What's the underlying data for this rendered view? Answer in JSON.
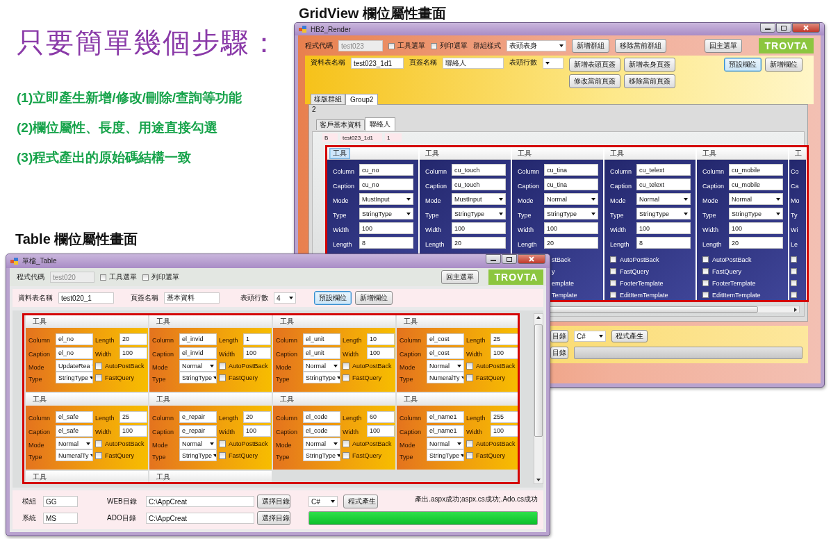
{
  "slide": {
    "title": "只要簡單幾個步驟：",
    "steps": [
      "(1)立即產生新增/修改/刪除/查詢等功能",
      "(2)欄位屬性、長度、用途直接勾選",
      "(3)程式產出的原始碼結構一致"
    ],
    "gridview_caption": "GridView 欄位屬性畫面",
    "table_caption": "Table 欄位屬性畫面"
  },
  "gridview_window": {
    "title": "HB2_Render",
    "program_code": {
      "label": "程式代碼",
      "value": "test023",
      "disabled": true
    },
    "checkboxes": [
      {
        "label": "工具選單",
        "checked": false
      },
      {
        "label": "列印選單",
        "checked": false
      }
    ],
    "group_style": {
      "label": "群組樣式",
      "value": "表頭表身"
    },
    "group_buttons": [
      "新增群組",
      "移除當前群組"
    ],
    "home_button": "回主選單",
    "logo": "TROVTA",
    "table_name": {
      "label": "資料表名稱",
      "value": "test023_1d1"
    },
    "tab_name": {
      "label": "頁簽名稱",
      "value": "聯絡人"
    },
    "header_rows": {
      "label": "表頭行數"
    },
    "tab_buttons": [
      [
        "新增表頭頁簽",
        "新增表身頁簽"
      ],
      [
        "修改當前頁簽",
        "移除當前頁簽"
      ]
    ],
    "field_buttons": [
      {
        "label": "預設欄位",
        "focused": true
      },
      {
        "label": "新增欄位",
        "focused": false
      }
    ],
    "group_tabs": [
      {
        "label": "樣版群組",
        "selected": false
      },
      {
        "label": "Group2",
        "selected": true
      }
    ],
    "group_number": "2",
    "page_tabs": [
      {
        "label": "客戶基本資料",
        "selected": false
      },
      {
        "label": "聯絡人",
        "selected": true
      }
    ],
    "info_fields": [
      "B",
      "test023_1d1",
      "1"
    ],
    "cards": [
      {
        "kind": "full",
        "tool": "工具",
        "focused": true,
        "fields": [
          {
            "label": "Column",
            "value": "cu_no",
            "kind": "text"
          },
          {
            "label": "Caption",
            "value": "cu_no",
            "kind": "text"
          },
          {
            "label": "Mode",
            "value": "MustInput",
            "kind": "select"
          },
          {
            "label": "Type",
            "value": "StringType",
            "kind": "select"
          },
          {
            "label": "Width",
            "value": "100",
            "kind": "text"
          },
          {
            "label": "Length",
            "value": "8",
            "kind": "text"
          }
        ]
      },
      {
        "kind": "full",
        "tool": "工具",
        "focused": false,
        "fields": [
          {
            "label": "Column",
            "value": "cu_touch",
            "kind": "text"
          },
          {
            "label": "Caption",
            "value": "cu_touch",
            "kind": "text"
          },
          {
            "label": "Mode",
            "value": "MustInput",
            "kind": "select"
          },
          {
            "label": "Type",
            "value": "StringType",
            "kind": "select"
          },
          {
            "label": "Width",
            "value": "100",
            "kind": "text"
          },
          {
            "label": "Length",
            "value": "20",
            "kind": "text"
          }
        ]
      },
      {
        "kind": "full",
        "tool": "工具",
        "focused": false,
        "fields": [
          {
            "label": "Column",
            "value": "cu_tina",
            "kind": "text"
          },
          {
            "label": "Caption",
            "value": "cu_tina",
            "kind": "text"
          },
          {
            "label": "Mode",
            "value": "Normal",
            "kind": "select"
          },
          {
            "label": "Type",
            "value": "StringType",
            "kind": "select"
          },
          {
            "label": "Width",
            "value": "100",
            "kind": "text"
          },
          {
            "label": "Length",
            "value": "20",
            "kind": "text"
          }
        ],
        "options": [
          {
            "kind": "partial",
            "label": "stBack"
          },
          {
            "kind": "partial",
            "label": "y"
          },
          {
            "kind": "partial",
            "label": "emplate"
          },
          {
            "kind": "partial",
            "label": "Template"
          }
        ]
      },
      {
        "kind": "full",
        "tool": "工具",
        "focused": false,
        "fields": [
          {
            "label": "Column",
            "value": "cu_telext",
            "kind": "text"
          },
          {
            "label": "Caption",
            "value": "cu_telext",
            "kind": "text"
          },
          {
            "label": "Mode",
            "value": "Normal",
            "kind": "select"
          },
          {
            "label": "Type",
            "value": "StringType",
            "kind": "select"
          },
          {
            "label": "Width",
            "value": "100",
            "kind": "text"
          },
          {
            "label": "Length",
            "value": "8",
            "kind": "text"
          }
        ],
        "options": [
          {
            "kind": "checkbox",
            "label": "AutoPostBack",
            "checked": false
          },
          {
            "kind": "checkbox",
            "label": "FastQuery",
            "checked": false
          },
          {
            "kind": "checkbox",
            "label": "FooterTemplate",
            "checked": false
          },
          {
            "kind": "checkbox",
            "label": "EditItemTemplate",
            "checked": false
          }
        ]
      },
      {
        "kind": "full",
        "tool": "工具",
        "focused": false,
        "fields": [
          {
            "label": "Column",
            "value": "cu_mobile",
            "kind": "text"
          },
          {
            "label": "Caption",
            "value": "cu_mobile",
            "kind": "text"
          },
          {
            "label": "Mode",
            "value": "Normal",
            "kind": "select"
          },
          {
            "label": "Type",
            "value": "StringType",
            "kind": "select"
          },
          {
            "label": "Width",
            "value": "100",
            "kind": "text"
          },
          {
            "label": "Length",
            "value": "20",
            "kind": "text"
          }
        ],
        "options": [
          {
            "kind": "checkbox",
            "label": "AutoPostBack",
            "checked": false
          },
          {
            "kind": "checkbox",
            "label": "FastQuery",
            "checked": false
          },
          {
            "kind": "checkbox",
            "label": "FooterTemplate",
            "checked": false
          },
          {
            "kind": "checkbox",
            "label": "EditItemTemplate",
            "checked": false
          }
        ]
      },
      {
        "kind": "edge",
        "tool": "工",
        "focused": false,
        "fields": [
          {
            "label": "Co",
            "kind": "label_only"
          },
          {
            "label": "Ca",
            "kind": "label_only"
          },
          {
            "label": "Mo",
            "kind": "label_only"
          },
          {
            "label": "Ty",
            "kind": "label_only"
          },
          {
            "label": "Wi",
            "kind": "label_only"
          },
          {
            "label": "Le",
            "kind": "label_only"
          }
        ],
        "options": [
          {
            "kind": "box",
            "checked": false
          },
          {
            "kind": "box",
            "checked": false
          },
          {
            "kind": "box",
            "checked": false
          },
          {
            "kind": "box",
            "checked": false
          }
        ]
      }
    ],
    "bottom": {
      "dir_buttons": [
        "目錄",
        "目錄"
      ],
      "language": "C#",
      "generate_button": "程式產生",
      "progress": {
        "level": 0
      }
    }
  },
  "table_window": {
    "title": "單檔_Table",
    "program_code": {
      "label": "程式代碼",
      "value": "test020",
      "disabled": true
    },
    "checkboxes": [
      {
        "label": "工具選單",
        "checked": false
      },
      {
        "label": "列印選單",
        "checked": false
      }
    ],
    "home_button": "回主選單",
    "logo": "TROVTA",
    "table_name": {
      "label": "資料表名稱",
      "value": "test020_1"
    },
    "tab_name": {
      "label": "頁簽名稱",
      "value": "基本資料"
    },
    "header_rows": {
      "label": "表頭行數",
      "value": "4"
    },
    "field_buttons": [
      {
        "label": "預設欄位",
        "focused": true
      },
      {
        "label": "新增欄位",
        "focused": false
      }
    ],
    "cards": [
      {
        "kind": "full",
        "tool": "工具",
        "fields": [
          {
            "label": "Column",
            "value": "el_no",
            "kind": "text"
          },
          {
            "label": "Caption",
            "value": "el_no",
            "kind": "text"
          },
          {
            "label": "Mode",
            "value": "UpdateRea",
            "kind": "select"
          },
          {
            "label": "Type",
            "value": "StringType",
            "kind": "select"
          }
        ],
        "side": [
          {
            "label": "Length",
            "value": "20",
            "kind": "text"
          },
          {
            "label": "Width",
            "value": "100",
            "kind": "text"
          },
          {
            "label": "AutoPostBack",
            "checked": false,
            "kind": "checkbox"
          },
          {
            "label": "FastQuery",
            "checked": false,
            "kind": "checkbox"
          }
        ]
      },
      {
        "kind": "full",
        "tool": "工具",
        "fields": [
          {
            "label": "Column",
            "value": "el_invid",
            "kind": "text"
          },
          {
            "label": "Caption",
            "value": "el_invid",
            "kind": "text"
          },
          {
            "label": "Mode",
            "value": "Normal",
            "kind": "select"
          },
          {
            "label": "Type",
            "value": "StringType",
            "kind": "select"
          }
        ],
        "side": [
          {
            "label": "Length",
            "value": "1",
            "kind": "text"
          },
          {
            "label": "Width",
            "value": "100",
            "kind": "text"
          },
          {
            "label": "AutoPostBack",
            "checked": false,
            "kind": "checkbox"
          },
          {
            "label": "FastQuery",
            "checked": false,
            "kind": "checkbox"
          }
        ]
      },
      {
        "kind": "full",
        "tool": "工具",
        "fields": [
          {
            "label": "Column",
            "value": "el_unit",
            "kind": "text"
          },
          {
            "label": "Caption",
            "value": "el_unit",
            "kind": "text"
          },
          {
            "label": "Mode",
            "value": "Normal",
            "kind": "select"
          },
          {
            "label": "Type",
            "value": "StringType",
            "kind": "select"
          }
        ],
        "side": [
          {
            "label": "Length",
            "value": "10",
            "kind": "text"
          },
          {
            "label": "Width",
            "value": "100",
            "kind": "text"
          },
          {
            "label": "AutoPostBack",
            "checked": false,
            "kind": "checkbox"
          },
          {
            "label": "FastQuery",
            "checked": false,
            "kind": "checkbox"
          }
        ]
      },
      {
        "kind": "full",
        "tool": "工具",
        "fields": [
          {
            "label": "Column",
            "value": "el_cost",
            "kind": "text"
          },
          {
            "label": "Caption",
            "value": "el_cost",
            "kind": "text"
          },
          {
            "label": "Mode",
            "value": "Normal",
            "kind": "select"
          },
          {
            "label": "Type",
            "value": "NumeralTy",
            "kind": "select"
          }
        ],
        "side": [
          {
            "label": "Length",
            "value": "25",
            "kind": "text"
          },
          {
            "label": "Width",
            "value": "100",
            "kind": "text"
          },
          {
            "label": "AutoPostBack",
            "checked": false,
            "kind": "checkbox"
          },
          {
            "label": "FastQuery",
            "checked": false,
            "kind": "checkbox"
          }
        ]
      },
      {
        "kind": "full",
        "tool": "工具",
        "fields": [
          {
            "label": "Column",
            "value": "el_safe",
            "kind": "text"
          },
          {
            "label": "Caption",
            "value": "el_safe",
            "kind": "text"
          },
          {
            "label": "Mode",
            "value": "Normal",
            "kind": "select"
          },
          {
            "label": "Type",
            "value": "NumeralTy",
            "kind": "select"
          }
        ],
        "side": [
          {
            "label": "Length",
            "value": "25",
            "kind": "text"
          },
          {
            "label": "Width",
            "value": "100",
            "kind": "text"
          },
          {
            "label": "AutoPostBack",
            "checked": false,
            "kind": "checkbox"
          },
          {
            "label": "FastQuery",
            "checked": false,
            "kind": "checkbox"
          }
        ]
      },
      {
        "kind": "full",
        "tool": "工具",
        "fields": [
          {
            "label": "Column",
            "value": "e_repair",
            "kind": "text"
          },
          {
            "label": "Caption",
            "value": "e_repair",
            "kind": "text"
          },
          {
            "label": "Mode",
            "value": "Normal",
            "kind": "select"
          },
          {
            "label": "Type",
            "value": "StringType",
            "kind": "select"
          }
        ],
        "side": [
          {
            "label": "Length",
            "value": "20",
            "kind": "text"
          },
          {
            "label": "Width",
            "value": "100",
            "kind": "text"
          },
          {
            "label": "AutoPostBack",
            "checked": false,
            "kind": "checkbox"
          },
          {
            "label": "FastQuery",
            "checked": false,
            "kind": "checkbox"
          }
        ]
      },
      {
        "kind": "full",
        "tool": "工具",
        "fields": [
          {
            "label": "Column",
            "value": "el_code",
            "kind": "text"
          },
          {
            "label": "Caption",
            "value": "el_code",
            "kind": "text"
          },
          {
            "label": "Mode",
            "value": "Normal",
            "kind": "select"
          },
          {
            "label": "Type",
            "value": "StringType",
            "kind": "select"
          }
        ],
        "side": [
          {
            "label": "Length",
            "value": "60",
            "kind": "text"
          },
          {
            "label": "Width",
            "value": "100",
            "kind": "text"
          },
          {
            "label": "AutoPostBack",
            "checked": false,
            "kind": "checkbox"
          },
          {
            "label": "FastQuery",
            "checked": false,
            "kind": "checkbox"
          }
        ]
      },
      {
        "kind": "full",
        "tool": "工具",
        "fields": [
          {
            "label": "Column",
            "value": "el_name1",
            "kind": "text"
          },
          {
            "label": "Caption",
            "value": "el_name1",
            "kind": "text"
          },
          {
            "label": "Mode",
            "value": "Normal",
            "kind": "select"
          },
          {
            "label": "Type",
            "value": "StringType",
            "kind": "select"
          }
        ],
        "side": [
          {
            "label": "Length",
            "value": "255",
            "kind": "text"
          },
          {
            "label": "Width",
            "value": "100",
            "kind": "text"
          },
          {
            "label": "AutoPostBack",
            "checked": false,
            "kind": "checkbox"
          },
          {
            "label": "FastQuery",
            "checked": false,
            "kind": "checkbox"
          }
        ]
      },
      {
        "kind": "header_only",
        "tool": "工具"
      },
      {
        "kind": "header_only",
        "tool": "工具"
      }
    ],
    "bottom": {
      "module": {
        "label": "模組",
        "value": "GG"
      },
      "system": {
        "label": "系統",
        "value": "MS"
      },
      "dirs": [
        {
          "label": "WEB目錄",
          "value": "C:\\AppCreat",
          "button": "選擇目錄"
        },
        {
          "label": "ADO目錄",
          "value": "C:\\AppCreat",
          "button": "選擇目錄"
        }
      ],
      "language": "C#",
      "generate_button": "程式產生",
      "message": "產出.aspx成功;aspx.cs成功;.Ado.cs成功",
      "progress": {
        "level": 1
      }
    }
  }
}
